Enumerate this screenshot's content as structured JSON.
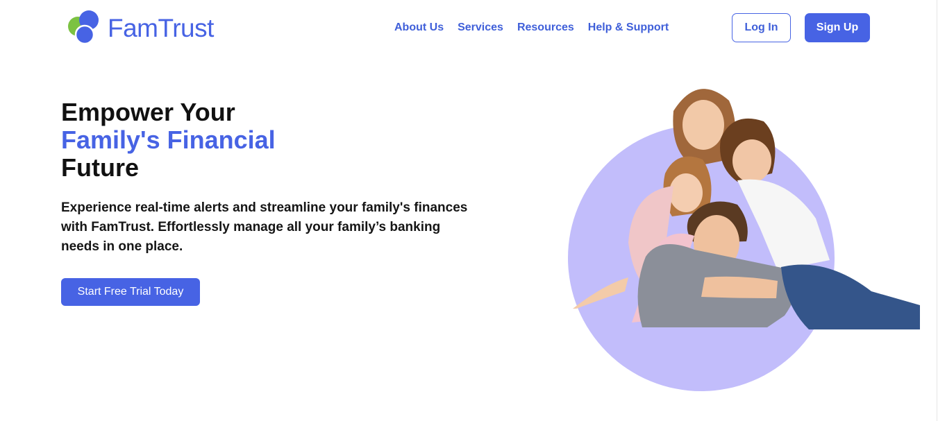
{
  "brand": {
    "name": "FamTrust",
    "accent_color": "#4763e4",
    "logo_icon": "overlapping-circles-logo"
  },
  "nav": {
    "items": [
      {
        "label": "About Us"
      },
      {
        "label": "Services"
      },
      {
        "label": "Resources"
      },
      {
        "label": "Help & Support"
      }
    ]
  },
  "auth": {
    "login_label": "Log In",
    "signup_label": "Sign Up"
  },
  "hero": {
    "title_line1": "Empower Your",
    "title_line2": "Family's Financial",
    "title_line3": "Future",
    "description": "Experience real-time alerts and streamline your family's finances with FamTrust. Effortlessly manage all your family’s banking needs in one place.",
    "cta_label": "Start Free Trial Today",
    "image": "family-photo",
    "circle_color": "#c2bdfb"
  }
}
